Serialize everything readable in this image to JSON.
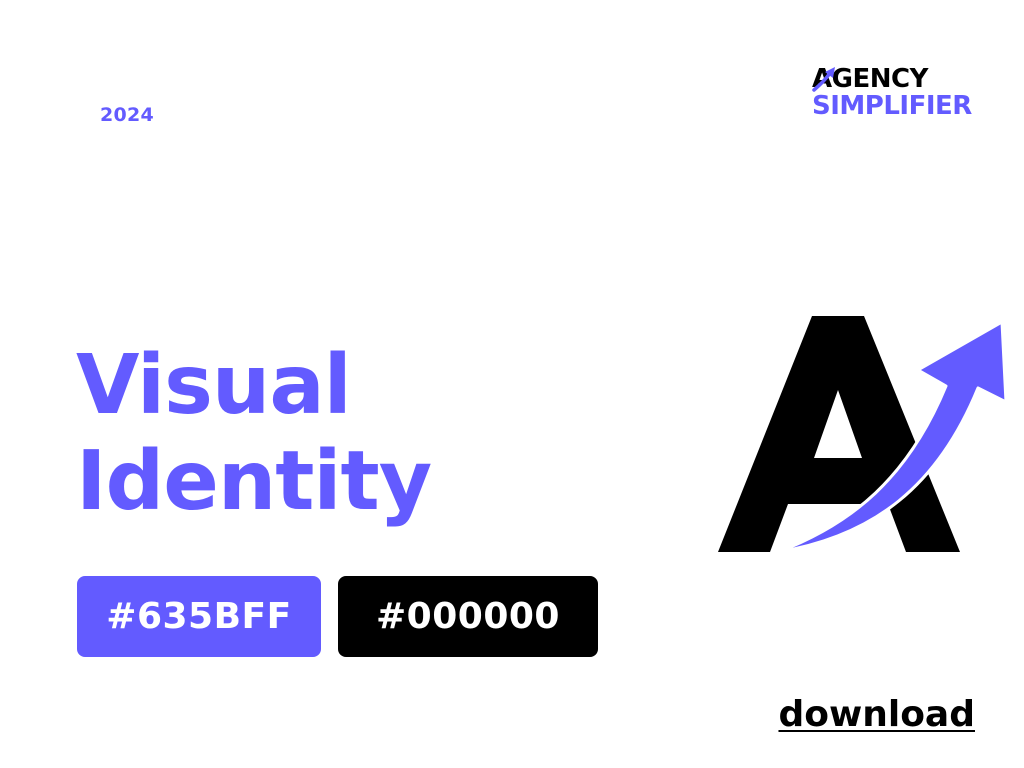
{
  "header": {
    "year": "2024",
    "brand": {
      "line1": "AGENCY",
      "line2": "SIMPLIFIER"
    }
  },
  "main": {
    "title_line1": "Visual",
    "title_line2": "Identity"
  },
  "palette": [
    {
      "label": "#635BFF",
      "color": "#635BFF"
    },
    {
      "label": "#000000",
      "color": "#000000"
    }
  ],
  "logo": {
    "icon": "brand-a-arrow-icon",
    "letter_color": "#000000",
    "arrow_color": "#635BFF"
  },
  "footer": {
    "download_label": "download"
  }
}
